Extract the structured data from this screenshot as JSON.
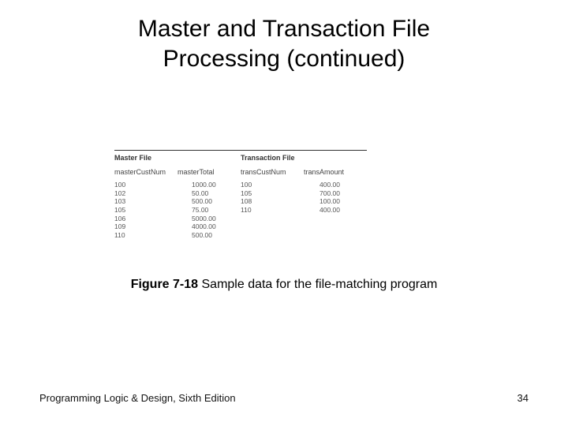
{
  "title_line1": "Master and Transaction File",
  "title_line2": "Processing (continued)",
  "figure": {
    "master_label": "Master File",
    "transaction_label": "Transaction File",
    "columns": {
      "masterCustNum": "masterCustNum",
      "masterTotal": "masterTotal",
      "transCustNum": "transCustNum",
      "transAmount": "transAmount"
    },
    "master_rows": [
      {
        "num": "100",
        "total": "1000.00"
      },
      {
        "num": "102",
        "total": "50.00"
      },
      {
        "num": "103",
        "total": "500.00"
      },
      {
        "num": "105",
        "total": "75.00"
      },
      {
        "num": "106",
        "total": "5000.00"
      },
      {
        "num": "109",
        "total": "4000.00"
      },
      {
        "num": "110",
        "total": "500.00"
      }
    ],
    "trans_rows": [
      {
        "num": "100",
        "amount": "400.00"
      },
      {
        "num": "105",
        "amount": "700.00"
      },
      {
        "num": "108",
        "amount": "100.00"
      },
      {
        "num": "110",
        "amount": "400.00"
      }
    ]
  },
  "caption_prefix": "Figure 7-18",
  "caption_rest": " Sample data for the file-matching program",
  "footer_left": "Programming Logic & Design, Sixth Edition",
  "footer_right": "34"
}
